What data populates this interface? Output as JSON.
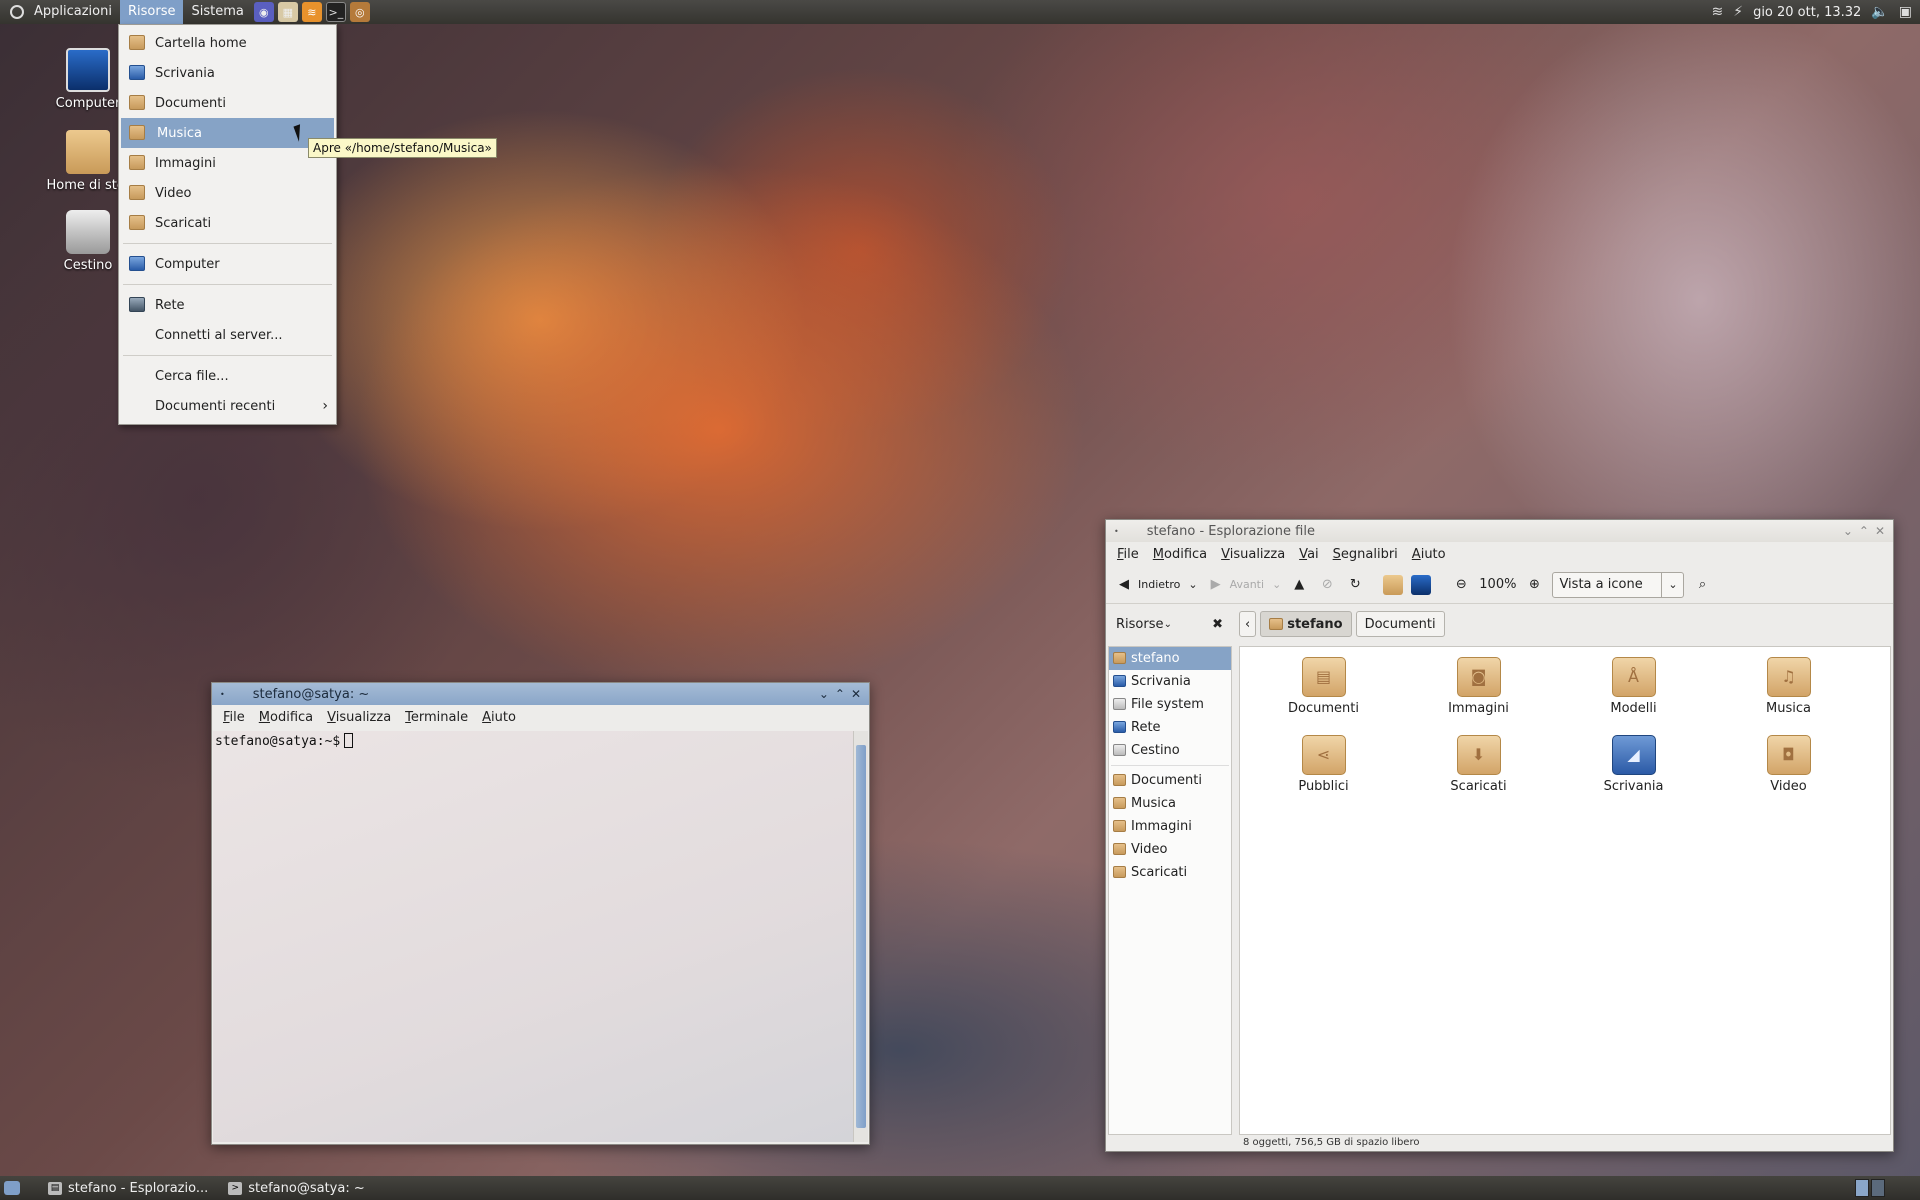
{
  "top_panel": {
    "menus": [
      "Applicazioni",
      "Risorse",
      "Sistema"
    ],
    "active_menu": "Risorse",
    "clock": "gio 20 ott, 13.32"
  },
  "desktop_icons": [
    {
      "label": "Computer"
    },
    {
      "label": "Home di stef"
    },
    {
      "label": "Cestino"
    }
  ],
  "places_menu": {
    "group1": [
      "Cartella home",
      "Scrivania",
      "Documenti",
      "Musica",
      "Immagini",
      "Video",
      "Scaricati"
    ],
    "highlighted": "Musica",
    "computer": "Computer",
    "rete": "Rete",
    "connect": "Connetti al server...",
    "search": "Cerca file...",
    "recent": "Documenti recenti",
    "tooltip": "Apre «/home/stefano/Musica»"
  },
  "terminal": {
    "title": "stefano@satya: ~",
    "menu": [
      "File",
      "Modifica",
      "Visualizza",
      "Terminale",
      "Aiuto"
    ],
    "prompt": "stefano@satya:~$"
  },
  "file_manager": {
    "title": "stefano - Esplorazione file",
    "menu": [
      "File",
      "Modifica",
      "Visualizza",
      "Vai",
      "Segnalibri",
      "Aiuto"
    ],
    "back_label": "Indietro",
    "forward_label": "Avanti",
    "zoom": "100%",
    "view_mode": "Vista a icone",
    "places_label": "Risorse",
    "breadcrumb": [
      "stefano",
      "Documenti"
    ],
    "sidebar_main": [
      "stefano",
      "Scrivania",
      "File system",
      "Rete",
      "Cestino"
    ],
    "sidebar_bookmarks": [
      "Documenti",
      "Musica",
      "Immagini",
      "Video",
      "Scaricati"
    ],
    "files": [
      {
        "name": "Documenti",
        "icon": "document-icon"
      },
      {
        "name": "Immagini",
        "icon": "camera-icon"
      },
      {
        "name": "Modelli",
        "icon": "compass-icon"
      },
      {
        "name": "Musica",
        "icon": "music-note-icon"
      },
      {
        "name": "Pubblici",
        "icon": "share-icon"
      },
      {
        "name": "Scaricati",
        "icon": "download-icon"
      },
      {
        "name": "Scrivania",
        "icon": "desktop-icon"
      },
      {
        "name": "Video",
        "icon": "video-camera-icon"
      }
    ],
    "status": "8 oggetti, 756,5 GB di spazio libero"
  },
  "taskbar": {
    "tasks": [
      "stefano - Esplorazio...",
      "stefano@satya: ~"
    ]
  }
}
